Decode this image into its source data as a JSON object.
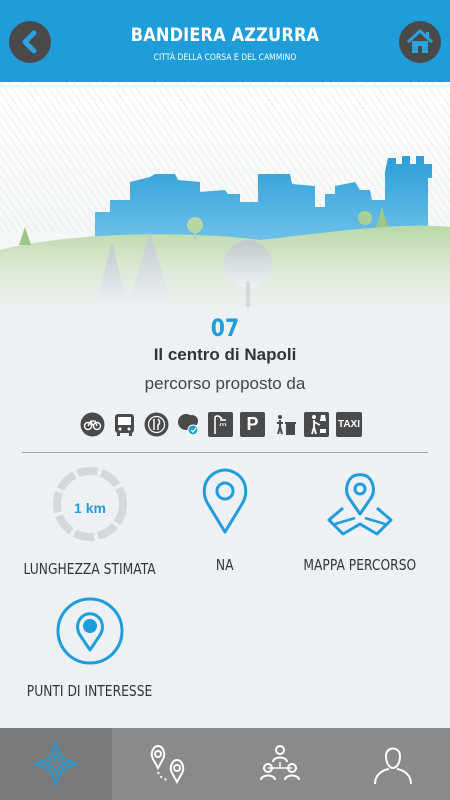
{
  "header": {
    "title": "BANDIERA AZZURRA",
    "subtitle": "CITTÀ DELLA CORSA E DEL CAMMINO",
    "back_icon": "chevron-left-icon",
    "home_icon": "home-icon"
  },
  "route": {
    "number": "07",
    "name": "Il centro di Napoli",
    "proposed_by": "percorso proposto da"
  },
  "amenities": [
    {
      "icon": "bicycle-icon"
    },
    {
      "icon": "bus-icon"
    },
    {
      "icon": "restaurant-icon"
    },
    {
      "icon": "water-fountain-icon"
    },
    {
      "icon": "shower-icon"
    },
    {
      "icon": "parking-icon",
      "label": "P"
    },
    {
      "icon": "waste-bin-icon"
    },
    {
      "icon": "dog-walk-icon"
    },
    {
      "icon": "taxi-icon",
      "label": "TAXI"
    }
  ],
  "features": {
    "length": {
      "value": "1 km",
      "label": "LUNGHEZZA STIMATA"
    },
    "location": {
      "label": "NA"
    },
    "map": {
      "label": "MAPPA PERCORSO"
    },
    "poi": {
      "label": "PUNTI DI INTERESSE"
    }
  },
  "nav": {
    "items": [
      {
        "icon": "compass-icon",
        "active": true
      },
      {
        "icon": "route-pins-icon",
        "active": false
      },
      {
        "icon": "community-icon",
        "active": false
      },
      {
        "icon": "user-profile-icon",
        "active": false
      }
    ]
  },
  "colors": {
    "accent": "#1f9ddb",
    "dark": "#4a4a4a",
    "nav_bg": "#8a8a8a",
    "background": "#eef1f3"
  }
}
